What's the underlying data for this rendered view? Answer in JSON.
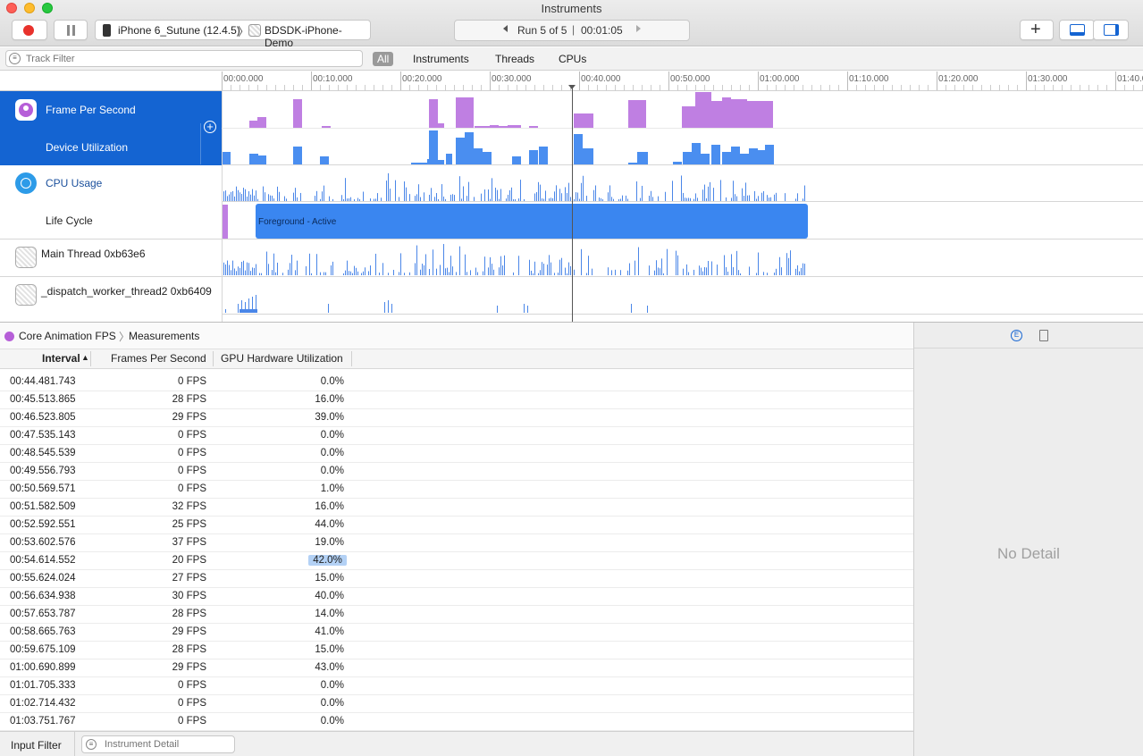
{
  "window": {
    "title": "Instruments"
  },
  "toolbar": {
    "device": "iPhone 6_Sutune (12.4.5)",
    "target": "BDSDK-iPhone-Demo",
    "run_label": "Run 5 of 5",
    "elapsed": "00:01:05"
  },
  "filterbar": {
    "placeholder": "Track Filter",
    "tabs": [
      "All",
      "Instruments",
      "Threads",
      "CPUs"
    ]
  },
  "ruler": {
    "ticks": [
      "00:00.000",
      "00:10.000",
      "00:20.000",
      "00:30.000",
      "00:40.000",
      "00:50.000",
      "01:00.000",
      "01:10.000",
      "01:20.000",
      "01:30.000",
      "01:40.000"
    ]
  },
  "tracks": {
    "fps": "Frame Per Second",
    "device_util": "Device Utilization",
    "cpu": "CPU Usage",
    "lifecycle": "Life Cycle",
    "lifecycle_state": "Foreground - Active",
    "main_thread": "Main Thread  0xb63e6",
    "worker_thread": "_dispatch_worker_thread2  0xb6409"
  },
  "breadcrumb": {
    "instrument": "Core Animation FPS",
    "view": "Measurements"
  },
  "table": {
    "columns": [
      "Interval",
      "Frames Per Second",
      "GPU Hardware Utilization"
    ],
    "rows": [
      [
        "00:44.481.743",
        "0 FPS",
        "0.0%"
      ],
      [
        "00:45.513.865",
        "28 FPS",
        "16.0%"
      ],
      [
        "00:46.523.805",
        "29 FPS",
        "39.0%"
      ],
      [
        "00:47.535.143",
        "0 FPS",
        "0.0%"
      ],
      [
        "00:48.545.539",
        "0 FPS",
        "0.0%"
      ],
      [
        "00:49.556.793",
        "0 FPS",
        "0.0%"
      ],
      [
        "00:50.569.571",
        "0 FPS",
        "1.0%"
      ],
      [
        "00:51.582.509",
        "32 FPS",
        "16.0%"
      ],
      [
        "00:52.592.551",
        "25 FPS",
        "44.0%"
      ],
      [
        "00:53.602.576",
        "37 FPS",
        "19.0%"
      ],
      [
        "00:54.614.552",
        "20 FPS",
        "42.0%"
      ],
      [
        "00:55.624.024",
        "27 FPS",
        "15.0%"
      ],
      [
        "00:56.634.938",
        "30 FPS",
        "40.0%"
      ],
      [
        "00:57.653.787",
        "28 FPS",
        "14.0%"
      ],
      [
        "00:58.665.763",
        "29 FPS",
        "41.0%"
      ],
      [
        "00:59.675.109",
        "28 FPS",
        "15.0%"
      ],
      [
        "01:00.690.899",
        "29 FPS",
        "43.0%"
      ],
      [
        "01:01.705.333",
        "0 FPS",
        "0.0%"
      ],
      [
        "01:02.714.432",
        "0 FPS",
        "0.0%"
      ],
      [
        "01:03.751.767",
        "0 FPS",
        "0.0%"
      ]
    ],
    "highlighted_row": 10
  },
  "detail": {
    "empty_text": "No Detail"
  },
  "bottom": {
    "input_filter": "Input Filter",
    "instrument_detail_placeholder": "Instrument Detail"
  },
  "colors": {
    "accent": "#1464d2",
    "fps_bar": "#bf7fe2",
    "util_bar": "#4a8ef0",
    "cpu_bar": "#4a86e8",
    "record": "#e8322c"
  }
}
